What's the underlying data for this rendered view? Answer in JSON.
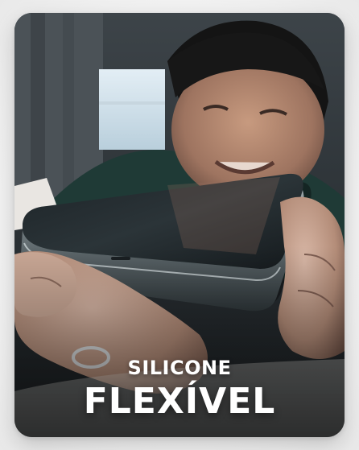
{
  "card": {
    "caption_top": "SILICONE",
    "caption_bottom": "FLEXÍVEL"
  },
  "image": {
    "subject": "person holding a phone with a clear flexible silicone case toward the camera"
  },
  "colors": {
    "caption_text": "#ffffff",
    "page_background": "#f1f1f1"
  }
}
